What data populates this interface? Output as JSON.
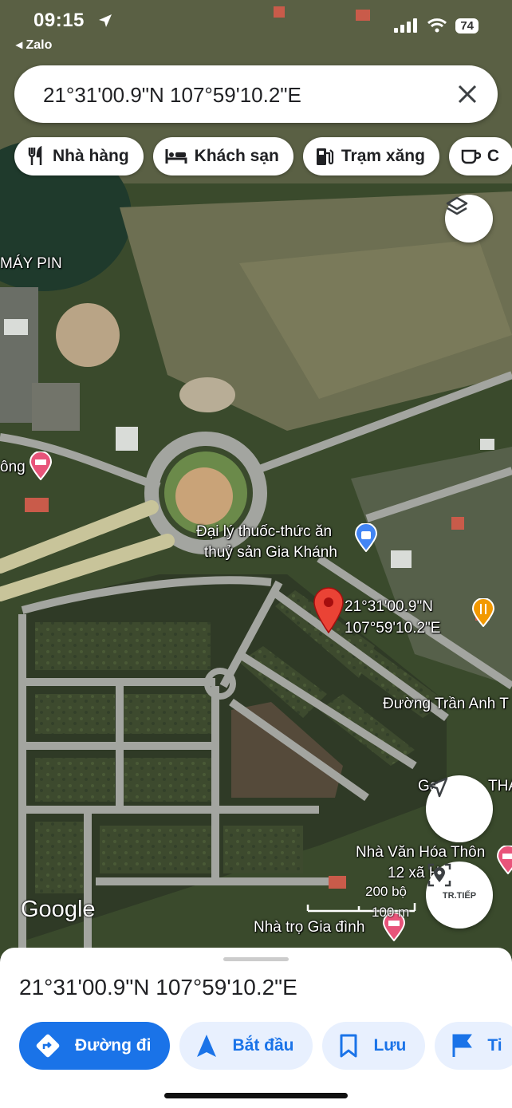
{
  "status_bar": {
    "time": "09:15",
    "back_app": "◂ Zalo",
    "battery": "74"
  },
  "search": {
    "query": "21°31'00.9\"N 107°59'10.2\"E"
  },
  "chips": [
    {
      "label": "Nhà hàng",
      "icon": "fork-knife-icon"
    },
    {
      "label": "Khách sạn",
      "icon": "bed-icon"
    },
    {
      "label": "Trạm xăng",
      "icon": "gas-pump-icon"
    },
    {
      "label": "C",
      "icon": "coffee-icon"
    }
  ],
  "map_labels": {
    "may_pin": "MÁY PIN",
    "ong": "ông",
    "dai_ly_1": "Đại lý thuốc-thức ăn",
    "dai_ly_2": "thuỷ sản Gia Khánh",
    "pin_1": "21°31'00.9\"N",
    "pin_2": "107°59'10.2\"E",
    "duong_tran": "Đường Trần Anh T",
    "ga": "Ga",
    "tha": "THA",
    "nha_van_hoa_1": "Nhà Văn Hóa Thôn",
    "nha_van_hoa_2": "12 xã H",
    "nha_tro": "Nhà trọ Gia đình",
    "google": "Google",
    "scale_ft": "200 bộ",
    "scale_m": "100 m",
    "tr_tiep": "TR.TIẾP"
  },
  "sheet": {
    "title": "21°31'00.9\"N 107°59'10.2\"E",
    "actions": [
      "Đường đi",
      "Bắt đầu",
      "Lưu",
      "Ti"
    ]
  },
  "colors": {
    "accent": "#1a73e8",
    "pin": "#ea4335",
    "hotel_pin": "#e8547a",
    "food_pin": "#f29900"
  }
}
